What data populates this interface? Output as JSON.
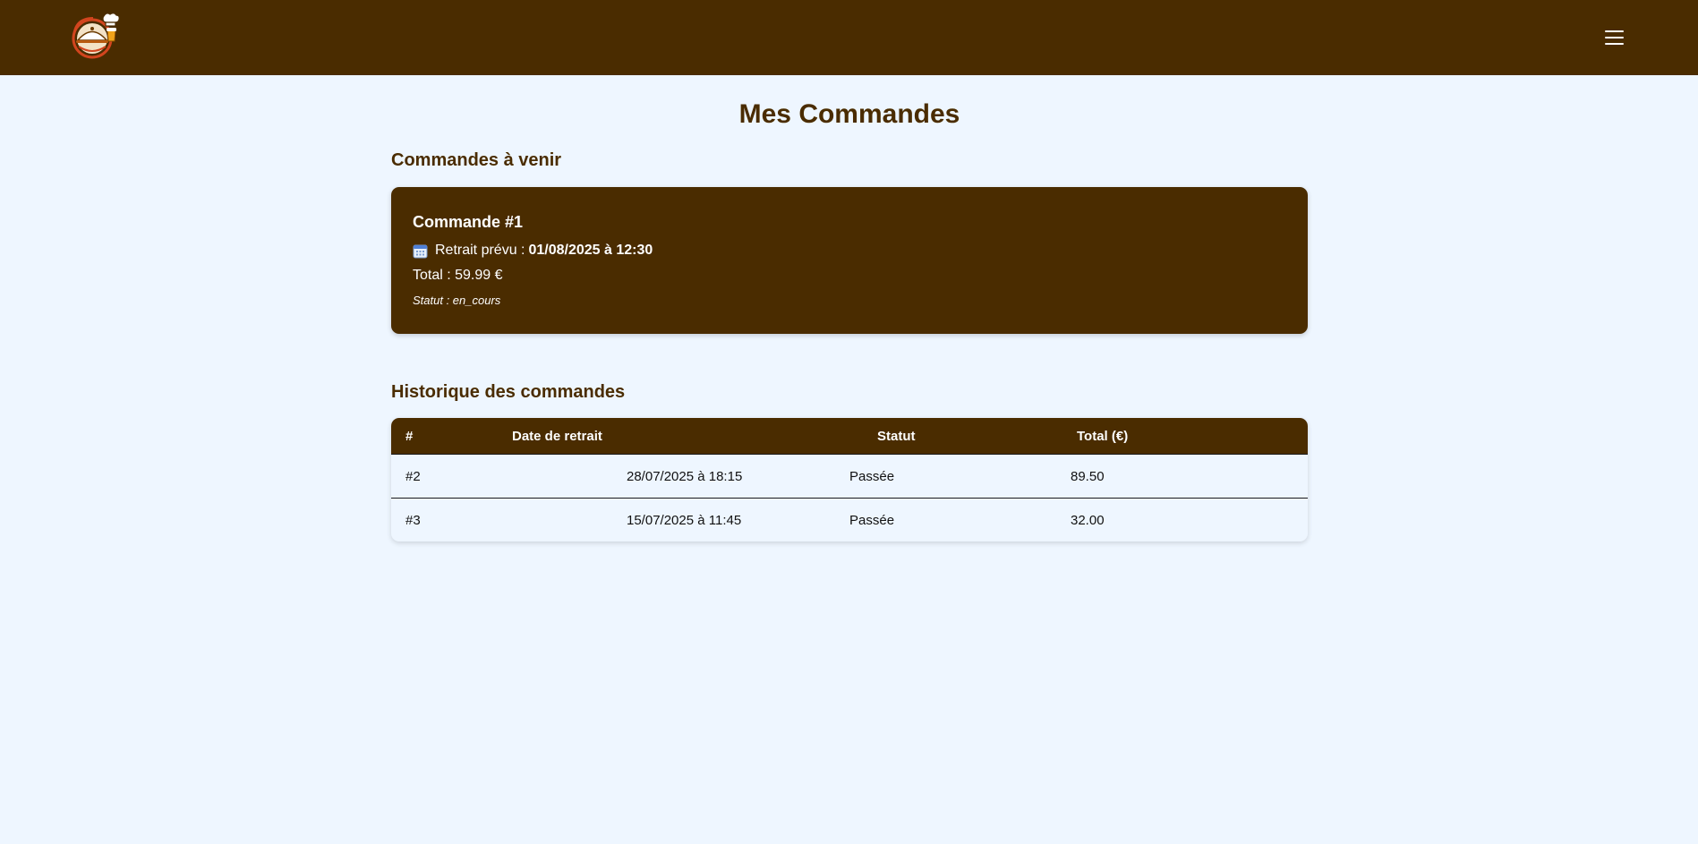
{
  "header": {
    "logo_icon": "chef-cloche-logo-icon",
    "menu_icon": "hamburger-menu-icon",
    "background_color": "#4a2c00"
  },
  "page": {
    "title": "Mes Commandes"
  },
  "upcoming": {
    "section_title": "Commandes à venir",
    "orders": [
      {
        "title": "Commande #1",
        "pickup_label": "Retrait prévu :",
        "pickup_value": "01/08/2025 à 12:30",
        "total_text": "Total : 59.99 €",
        "status_text": "Statut : en_cours",
        "icon": "calendar-icon"
      }
    ]
  },
  "history": {
    "section_title": "Historique des commandes",
    "columns": [
      "#",
      "Date de retrait",
      "Statut",
      "Total (€)"
    ],
    "rows": [
      {
        "id": "#2",
        "date": "28/07/2025 à 18:15",
        "status": "Passée",
        "total": "89.50"
      },
      {
        "id": "#3",
        "date": "15/07/2025 à 11:45",
        "status": "Passée",
        "total": "32.00"
      }
    ]
  },
  "colors": {
    "brand_brown": "#4a2c00",
    "page_background": "#eef6ff",
    "text_light": "#ffffff"
  }
}
